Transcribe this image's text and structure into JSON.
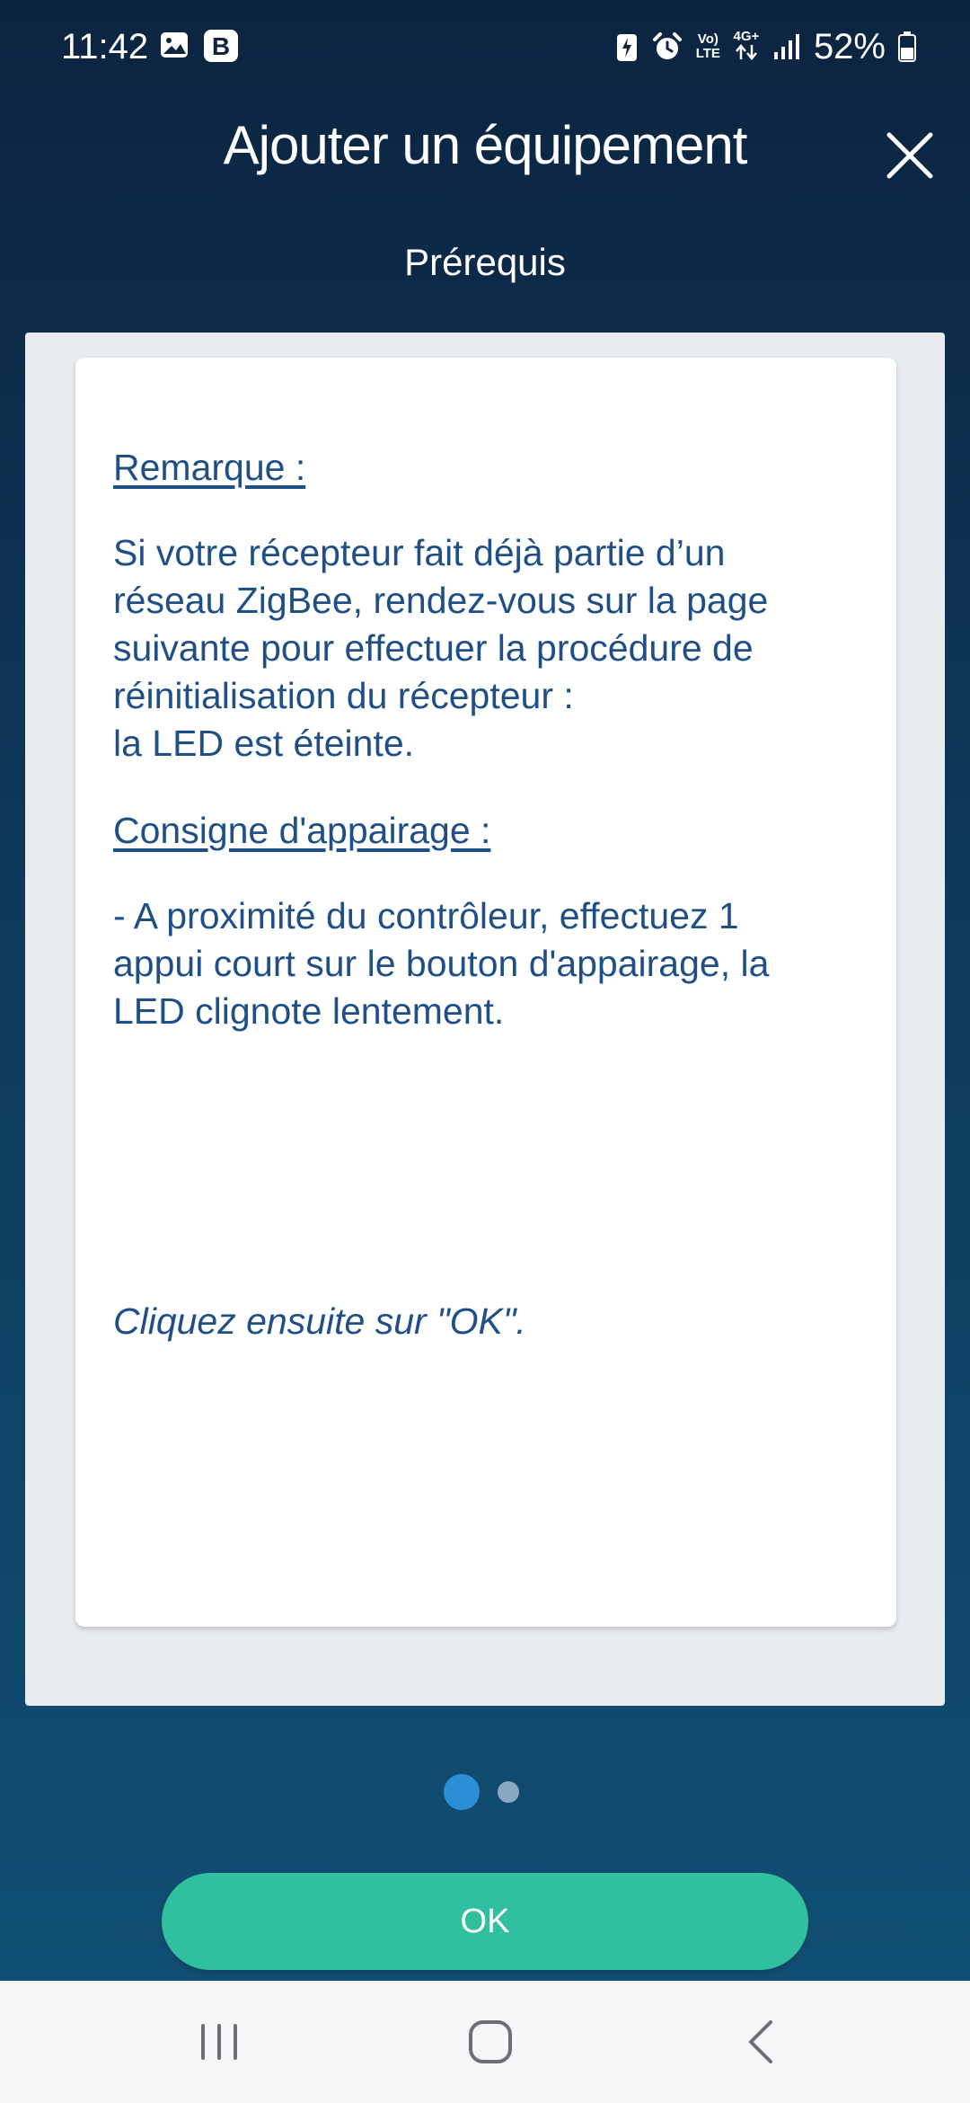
{
  "status_bar": {
    "time": "11:42",
    "battery_percent": "52%",
    "volte_label_top": "Vo)",
    "volte_label_bottom": "LTE",
    "network_label": "4G+",
    "notification_badge_letter": "B",
    "battery_level": 0.52
  },
  "header": {
    "title": "Ajouter un équipement",
    "subtitle": "Prérequis"
  },
  "card": {
    "remark_heading": "Remarque :",
    "remark_lines": [
      "Si votre récepteur fait déjà partie d’un",
      "réseau ZigBee, rendez-vous sur la page",
      "suivante pour effectuer la procédure de",
      "réinitialisation du récepteur :",
      "la LED est éteinte."
    ],
    "pairing_heading": "Consigne d'appairage :",
    "pairing_lines": [
      "- A proximité du contrôleur, effectuez 1",
      "appui court sur le bouton d'appairage, la",
      "LED clignote lentement."
    ],
    "final_instruction": "Cliquez ensuite sur \"OK\"."
  },
  "pager": {
    "current_page": 1,
    "total_pages": 2
  },
  "actions": {
    "ok_label": "OK"
  },
  "colors": {
    "accent_green": "#30bf9f",
    "text_blue": "#1f4f86",
    "pager_active": "#2b8fd6",
    "pager_inactive": "#8aa8c2"
  },
  "icons": {
    "close": "close-icon",
    "recents": "recent-apps-icon",
    "home": "home-icon",
    "back": "back-icon"
  }
}
